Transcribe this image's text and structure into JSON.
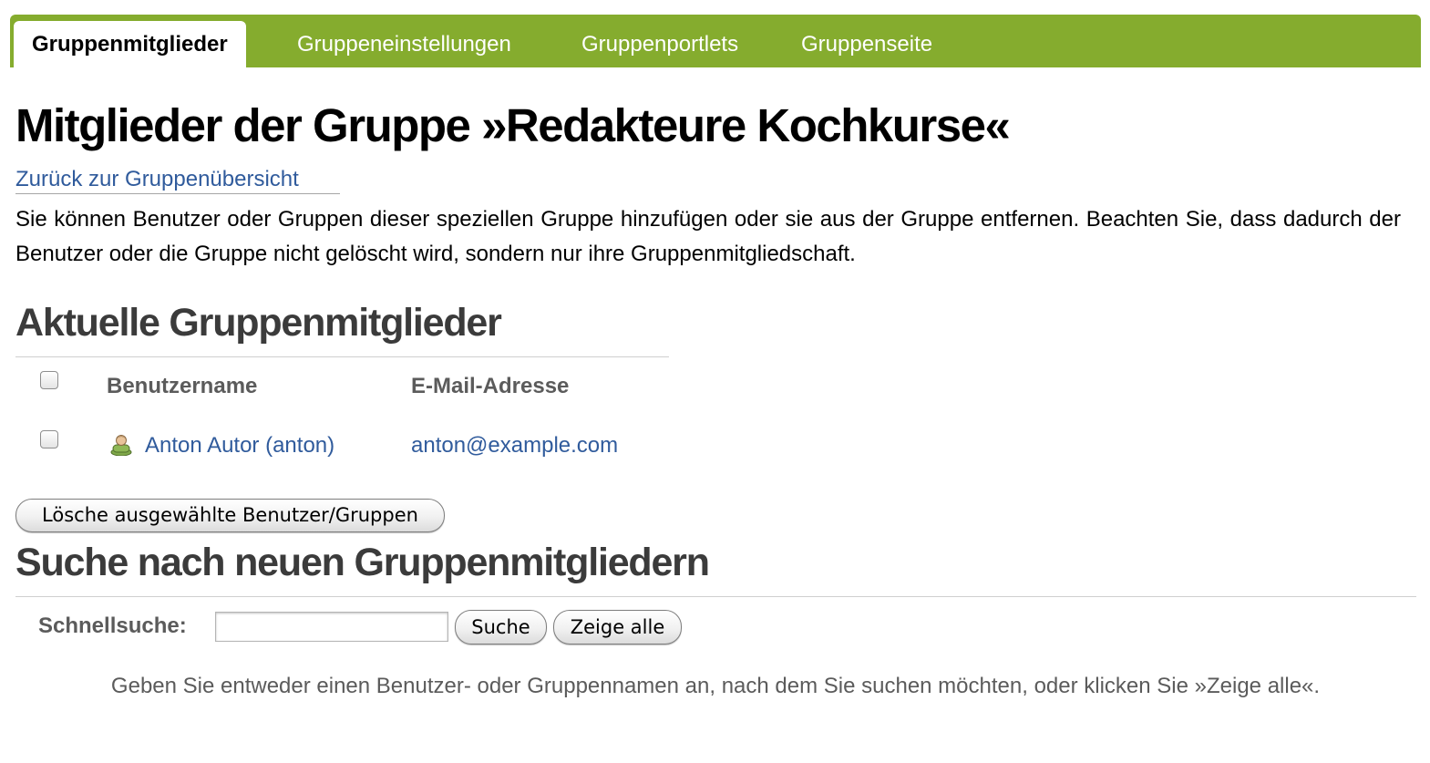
{
  "tabs": [
    {
      "label": "Gruppenmitglieder",
      "active": true
    },
    {
      "label": "Gruppeneinstellungen",
      "active": false
    },
    {
      "label": "Gruppenportlets",
      "active": false
    },
    {
      "label": "Gruppenseite",
      "active": false
    }
  ],
  "page_title": "Mitglieder der Gruppe »Redakteure Kochkurse«",
  "back_link": "Zurück zur Gruppenübersicht",
  "description": "Sie können Benutzer oder Gruppen dieser speziellen Gruppe hinzufügen oder sie aus der Gruppe entfernen. Beachten Sie, dass dadurch der Benutzer oder die Gruppe nicht gelöscht wird, sondern nur ihre Gruppenmitgliedschaft.",
  "members": {
    "heading": "Aktuelle Gruppenmitglieder",
    "columns": {
      "username": "Benutzername",
      "email": "E-Mail-Adresse"
    },
    "rows": [
      {
        "name": "Anton Autor (anton)",
        "email": "anton@example.com",
        "icon": "user-icon"
      }
    ],
    "delete_button": "Lösche ausgewählte Benutzer/Gruppen"
  },
  "search": {
    "heading": "Suche nach neuen Gruppenmitgliedern",
    "label": "Schnellsuche:",
    "value": "",
    "search_button": "Suche",
    "show_all_button": "Zeige alle",
    "hint": "Geben Sie entweder einen Benutzer- oder Gruppennamen an, nach dem Sie suchen möchten, oder klicken Sie »Zeige alle«."
  },
  "colors": {
    "tab_bar": "#85ac2e",
    "link": "#305b9c",
    "heading": "#3b3b3b"
  }
}
